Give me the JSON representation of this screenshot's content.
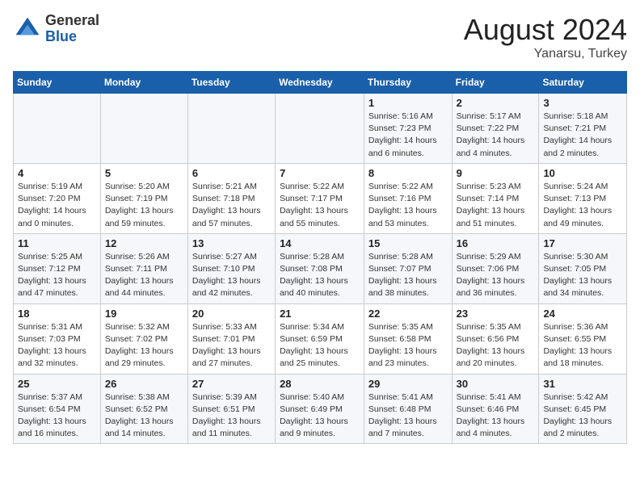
{
  "logo": {
    "general": "General",
    "blue": "Blue"
  },
  "header": {
    "title": "August 2024",
    "subtitle": "Yanarsu, Turkey"
  },
  "weekdays": [
    "Sunday",
    "Monday",
    "Tuesday",
    "Wednesday",
    "Thursday",
    "Friday",
    "Saturday"
  ],
  "weeks": [
    [
      {
        "day": "",
        "info": ""
      },
      {
        "day": "",
        "info": ""
      },
      {
        "day": "",
        "info": ""
      },
      {
        "day": "",
        "info": ""
      },
      {
        "day": "1",
        "info": "Sunrise: 5:16 AM\nSunset: 7:23 PM\nDaylight: 14 hours\nand 6 minutes."
      },
      {
        "day": "2",
        "info": "Sunrise: 5:17 AM\nSunset: 7:22 PM\nDaylight: 14 hours\nand 4 minutes."
      },
      {
        "day": "3",
        "info": "Sunrise: 5:18 AM\nSunset: 7:21 PM\nDaylight: 14 hours\nand 2 minutes."
      }
    ],
    [
      {
        "day": "4",
        "info": "Sunrise: 5:19 AM\nSunset: 7:20 PM\nDaylight: 14 hours\nand 0 minutes."
      },
      {
        "day": "5",
        "info": "Sunrise: 5:20 AM\nSunset: 7:19 PM\nDaylight: 13 hours\nand 59 minutes."
      },
      {
        "day": "6",
        "info": "Sunrise: 5:21 AM\nSunset: 7:18 PM\nDaylight: 13 hours\nand 57 minutes."
      },
      {
        "day": "7",
        "info": "Sunrise: 5:22 AM\nSunset: 7:17 PM\nDaylight: 13 hours\nand 55 minutes."
      },
      {
        "day": "8",
        "info": "Sunrise: 5:22 AM\nSunset: 7:16 PM\nDaylight: 13 hours\nand 53 minutes."
      },
      {
        "day": "9",
        "info": "Sunrise: 5:23 AM\nSunset: 7:14 PM\nDaylight: 13 hours\nand 51 minutes."
      },
      {
        "day": "10",
        "info": "Sunrise: 5:24 AM\nSunset: 7:13 PM\nDaylight: 13 hours\nand 49 minutes."
      }
    ],
    [
      {
        "day": "11",
        "info": "Sunrise: 5:25 AM\nSunset: 7:12 PM\nDaylight: 13 hours\nand 47 minutes."
      },
      {
        "day": "12",
        "info": "Sunrise: 5:26 AM\nSunset: 7:11 PM\nDaylight: 13 hours\nand 44 minutes."
      },
      {
        "day": "13",
        "info": "Sunrise: 5:27 AM\nSunset: 7:10 PM\nDaylight: 13 hours\nand 42 minutes."
      },
      {
        "day": "14",
        "info": "Sunrise: 5:28 AM\nSunset: 7:08 PM\nDaylight: 13 hours\nand 40 minutes."
      },
      {
        "day": "15",
        "info": "Sunrise: 5:28 AM\nSunset: 7:07 PM\nDaylight: 13 hours\nand 38 minutes."
      },
      {
        "day": "16",
        "info": "Sunrise: 5:29 AM\nSunset: 7:06 PM\nDaylight: 13 hours\nand 36 minutes."
      },
      {
        "day": "17",
        "info": "Sunrise: 5:30 AM\nSunset: 7:05 PM\nDaylight: 13 hours\nand 34 minutes."
      }
    ],
    [
      {
        "day": "18",
        "info": "Sunrise: 5:31 AM\nSunset: 7:03 PM\nDaylight: 13 hours\nand 32 minutes."
      },
      {
        "day": "19",
        "info": "Sunrise: 5:32 AM\nSunset: 7:02 PM\nDaylight: 13 hours\nand 29 minutes."
      },
      {
        "day": "20",
        "info": "Sunrise: 5:33 AM\nSunset: 7:01 PM\nDaylight: 13 hours\nand 27 minutes."
      },
      {
        "day": "21",
        "info": "Sunrise: 5:34 AM\nSunset: 6:59 PM\nDaylight: 13 hours\nand 25 minutes."
      },
      {
        "day": "22",
        "info": "Sunrise: 5:35 AM\nSunset: 6:58 PM\nDaylight: 13 hours\nand 23 minutes."
      },
      {
        "day": "23",
        "info": "Sunrise: 5:35 AM\nSunset: 6:56 PM\nDaylight: 13 hours\nand 20 minutes."
      },
      {
        "day": "24",
        "info": "Sunrise: 5:36 AM\nSunset: 6:55 PM\nDaylight: 13 hours\nand 18 minutes."
      }
    ],
    [
      {
        "day": "25",
        "info": "Sunrise: 5:37 AM\nSunset: 6:54 PM\nDaylight: 13 hours\nand 16 minutes."
      },
      {
        "day": "26",
        "info": "Sunrise: 5:38 AM\nSunset: 6:52 PM\nDaylight: 13 hours\nand 14 minutes."
      },
      {
        "day": "27",
        "info": "Sunrise: 5:39 AM\nSunset: 6:51 PM\nDaylight: 13 hours\nand 11 minutes."
      },
      {
        "day": "28",
        "info": "Sunrise: 5:40 AM\nSunset: 6:49 PM\nDaylight: 13 hours\nand 9 minutes."
      },
      {
        "day": "29",
        "info": "Sunrise: 5:41 AM\nSunset: 6:48 PM\nDaylight: 13 hours\nand 7 minutes."
      },
      {
        "day": "30",
        "info": "Sunrise: 5:41 AM\nSunset: 6:46 PM\nDaylight: 13 hours\nand 4 minutes."
      },
      {
        "day": "31",
        "info": "Sunrise: 5:42 AM\nSunset: 6:45 PM\nDaylight: 13 hours\nand 2 minutes."
      }
    ]
  ]
}
